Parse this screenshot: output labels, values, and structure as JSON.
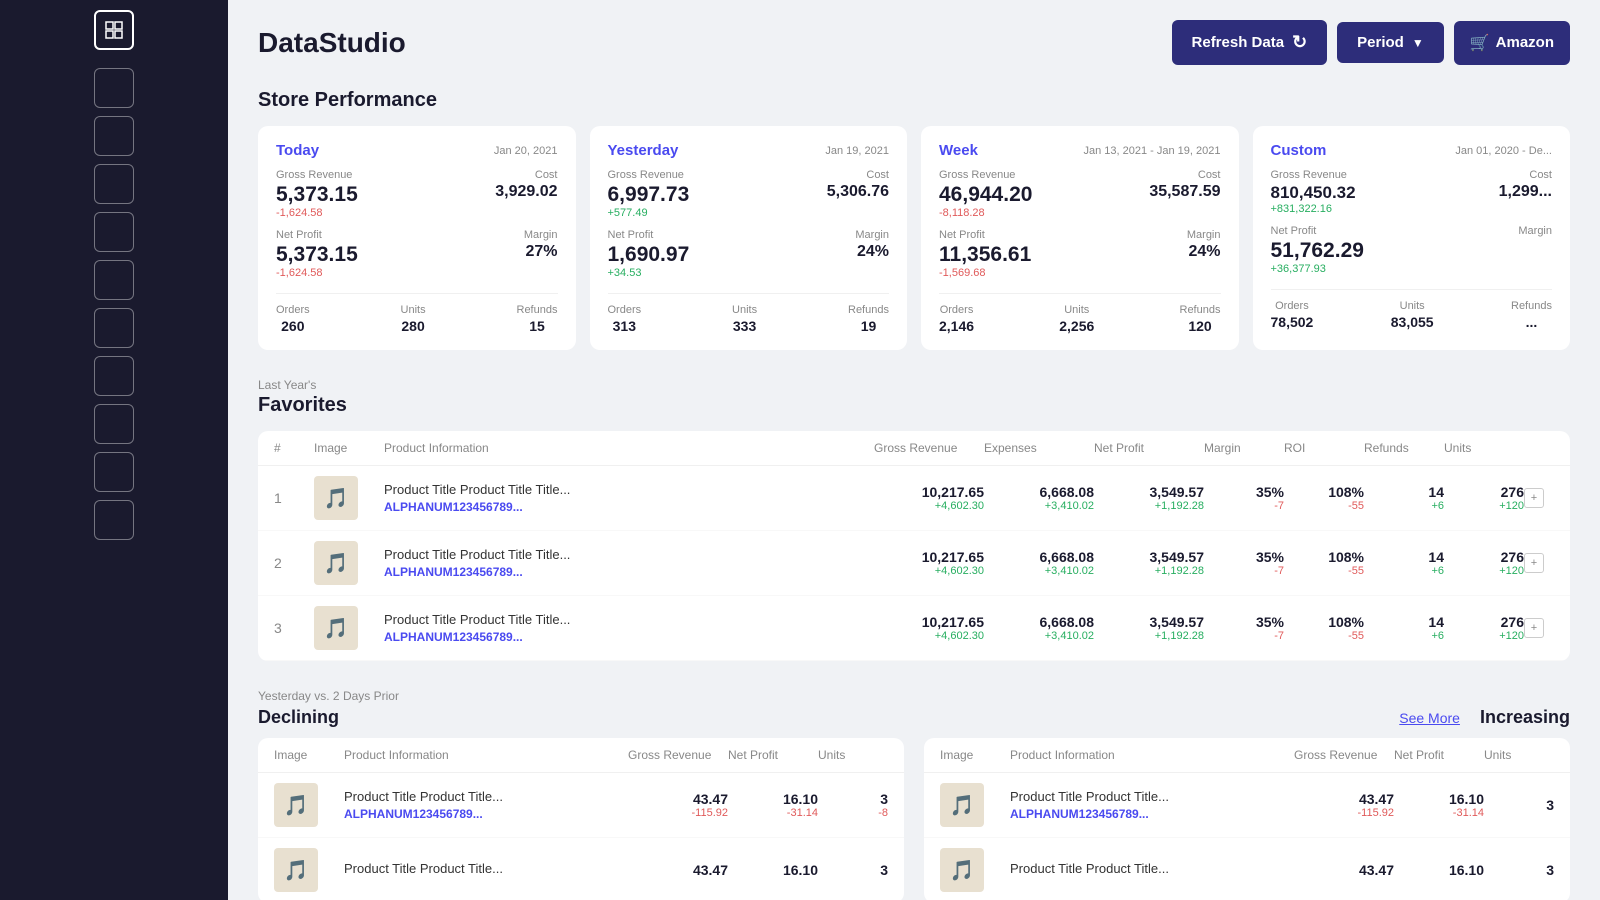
{
  "app": {
    "title": "DataStudio"
  },
  "header": {
    "refresh_label": "Refresh Data",
    "period_label": "Period",
    "amazon_label": "Amazon"
  },
  "store_performance": {
    "title": "Store Performance",
    "cards": [
      {
        "tab": "Today",
        "date": "Jan 20, 2021",
        "gross_revenue_label": "Gross Revenue",
        "cost_label": "Cost",
        "cost": "3,929.02",
        "gross_revenue": "5,373.15",
        "gross_delta": "-1,624.58",
        "gross_delta_type": "neg",
        "net_profit_label": "Net Profit",
        "margin_label": "Margin",
        "margin": "27%",
        "net_profit": "5,373.15",
        "net_delta": "-1,624.58",
        "net_delta_type": "neg",
        "orders_label": "Orders",
        "orders": "260",
        "units_label": "Units",
        "units": "280",
        "refunds_label": "Refunds",
        "refunds": "15"
      },
      {
        "tab": "Yesterday",
        "date": "Jan 19, 2021",
        "gross_revenue_label": "Gross Revenue",
        "cost_label": "Cost",
        "cost": "5,306.76",
        "gross_revenue": "6,997.73",
        "gross_delta": "+577.49",
        "gross_delta_type": "pos",
        "net_profit_label": "Net Profit",
        "margin_label": "Margin",
        "margin": "24%",
        "net_profit": "1,690.97",
        "net_delta": "+34.53",
        "net_delta_type": "pos",
        "orders_label": "Orders",
        "orders": "313",
        "units_label": "Units",
        "units": "333",
        "refunds_label": "Refunds",
        "refunds": "19"
      },
      {
        "tab": "Week",
        "date": "Jan 13, 2021 - Jan 19, 2021",
        "gross_revenue_label": "Gross Revenue",
        "cost_label": "Cost",
        "cost": "35,587.59",
        "gross_revenue": "46,944.20",
        "gross_delta": "-8,118.28",
        "gross_delta_type": "neg",
        "net_profit_label": "Net Profit",
        "margin_label": "Margin",
        "margin": "24%",
        "net_profit": "11,356.61",
        "net_delta": "-1,569.68",
        "net_delta_type": "neg",
        "orders_label": "Orders",
        "orders": "2,146",
        "units_label": "Units",
        "units": "2,256",
        "refunds_label": "Refunds",
        "refunds": "120"
      },
      {
        "tab": "Custom",
        "date": "Jan 01, 2020 - De...",
        "gross_revenue_label": "Gross Revenue",
        "cost_label": "Cost",
        "cost": "1,299...",
        "gross_revenue": "810,450.32",
        "gross_delta": "+831,322.16",
        "gross_delta_type": "pos",
        "net_profit_label": "Net Profit",
        "margin_label": "Margin",
        "margin": "",
        "net_profit": "51,762.29",
        "net_delta": "+36,377.93",
        "net_delta_type": "pos",
        "orders_label": "Orders",
        "orders": "78,502",
        "units_label": "Units",
        "units": "83,055",
        "refunds_label": "Refunds",
        "refunds": "..."
      }
    ]
  },
  "favorites": {
    "subtitle": "Last Year's",
    "title": "Favorites",
    "columns": [
      "#",
      "Image",
      "Product Information",
      "Gross Revenue",
      "Expenses",
      "Net Profit",
      "Margin",
      "ROI",
      "Refunds",
      "Units"
    ],
    "rows": [
      {
        "num": "1",
        "title": "Product Title Product Title Title...",
        "asin": "ALPHANUM123456789...",
        "gross_revenue": "10,217.65",
        "gross_delta": "+4,602.30",
        "expenses": "6,668.08",
        "exp_delta": "+3,410.02",
        "net_profit": "3,549.57",
        "net_delta": "+1,192.28",
        "margin": "35%",
        "margin_delta": "-7",
        "roi": "108%",
        "roi_delta": "-55",
        "refunds": "14",
        "refunds_delta": "+6",
        "units": "276",
        "units_delta": "+120"
      },
      {
        "num": "2",
        "title": "Product Title Product Title Title...",
        "asin": "ALPHANUM123456789...",
        "gross_revenue": "10,217.65",
        "gross_delta": "+4,602.30",
        "expenses": "6,668.08",
        "exp_delta": "+3,410.02",
        "net_profit": "3,549.57",
        "net_delta": "+1,192.28",
        "margin": "35%",
        "margin_delta": "-7",
        "roi": "108%",
        "roi_delta": "-55",
        "refunds": "14",
        "refunds_delta": "+6",
        "units": "276",
        "units_delta": "+120"
      },
      {
        "num": "3",
        "title": "Product Title Product Title Title...",
        "asin": "ALPHANUM123456789...",
        "gross_revenue": "10,217.65",
        "gross_delta": "+4,602.30",
        "expenses": "6,668.08",
        "exp_delta": "+3,410.02",
        "net_profit": "3,549.57",
        "net_delta": "+1,192.28",
        "margin": "35%",
        "margin_delta": "-7",
        "roi": "108%",
        "roi_delta": "-55",
        "refunds": "14",
        "refunds_delta": "+6",
        "units": "276",
        "units_delta": "+120"
      }
    ]
  },
  "di_section": {
    "compare_subtitle": "Yesterday vs. 2 Days Prior",
    "declining_title": "Declining",
    "increasing_title": "Increasing",
    "see_more_label": "See More",
    "columns": [
      "Image",
      "Product Information",
      "Gross Revenue",
      "Net Profit",
      "Units"
    ],
    "declining_rows": [
      {
        "title": "Product Title Product Title...",
        "asin": "ALPHANUM123456789...",
        "gross_revenue": "43.47",
        "gross_delta": "-115.92",
        "net_profit": "16.10",
        "net_delta": "-31.14",
        "units": "3",
        "units_delta": "-8"
      },
      {
        "title": "Product Title Product Title...",
        "asin": "",
        "gross_revenue": "43.47",
        "gross_delta": "",
        "net_profit": "16.10",
        "net_delta": "",
        "units": "3",
        "units_delta": ""
      }
    ],
    "increasing_rows": [
      {
        "title": "Product Title Product Title...",
        "asin": "ALPHANUM123456789...",
        "gross_revenue": "43.47",
        "gross_delta": "-115.92",
        "net_profit": "16.10",
        "net_delta": "-31.14",
        "units": "3",
        "units_delta": ""
      },
      {
        "title": "Product Title Product Title...",
        "asin": "",
        "gross_revenue": "43.47",
        "gross_delta": "",
        "net_profit": "16.10",
        "net_delta": "",
        "units": "3",
        "units_delta": ""
      }
    ]
  },
  "sidebar": {
    "items": [
      "",
      "",
      "",
      "",
      "",
      "",
      "",
      "",
      "",
      ""
    ]
  }
}
